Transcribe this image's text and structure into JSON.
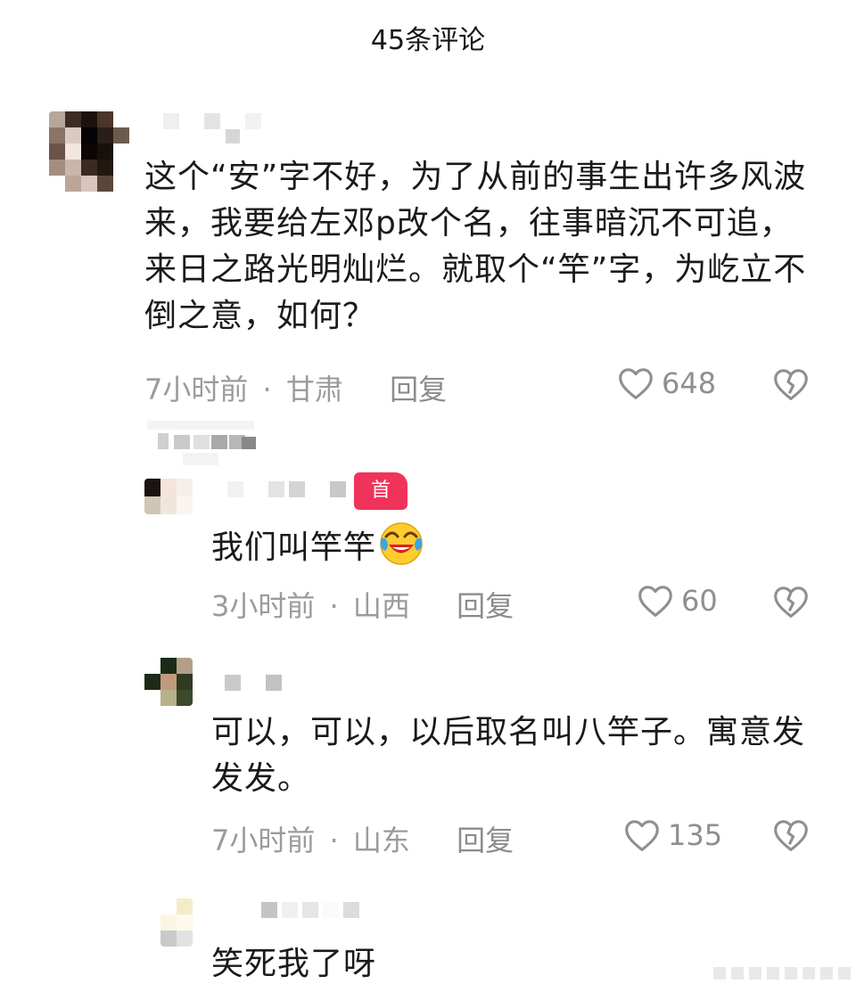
{
  "header": {
    "title": "45条评论"
  },
  "comments": [
    {
      "text": "这个“安”字不好，为了从前的事生出许多风波来，我要给左邓p改个名，往事暗沉不可追，来日之路光明灿烂。就取个“竿”字，为屹立不倒之意，如何？",
      "time": "7小时前",
      "location": "甘肃",
      "reply_label": "回复",
      "likes": "648"
    },
    {
      "text": "我们叫竿竿",
      "emoji": "crying-laughing-emoji",
      "badge": "首",
      "time": "3小时前",
      "location": "山西",
      "reply_label": "回复",
      "likes": "60"
    },
    {
      "text": "可以，可以，以后取名叫八竿子。寓意发发发。",
      "time": "7小时前",
      "location": "山东",
      "reply_label": "回复",
      "likes": "135"
    },
    {
      "text": "笑死我了呀"
    }
  ],
  "separator": "·",
  "icons": {
    "like": "heart-outline-icon",
    "dislike": "broken-heart-icon"
  },
  "colors": {
    "badge": "#f0335a",
    "meta": "#9b9b9b",
    "text": "#1a1a1a"
  }
}
